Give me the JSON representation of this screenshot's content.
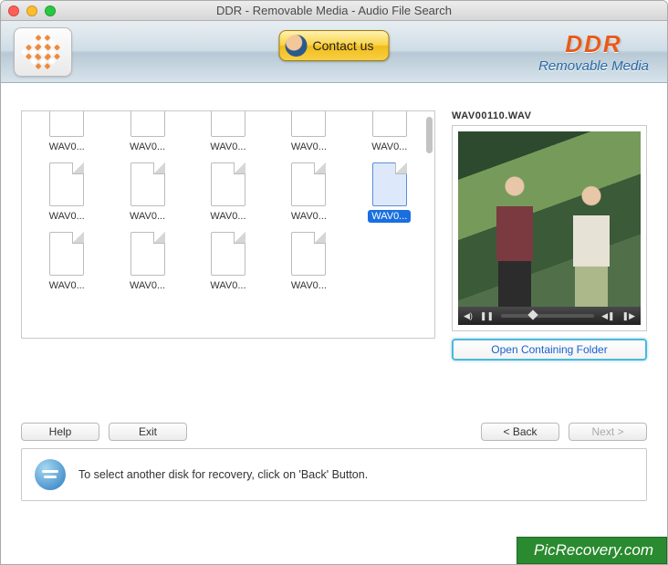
{
  "window": {
    "title": "DDR - Removable Media - Audio File Search"
  },
  "header": {
    "contact_label": "Contact us",
    "brand_title": "DDR",
    "brand_subtitle": "Removable Media"
  },
  "files": {
    "row_top": [
      "WAV0...",
      "WAV0...",
      "WAV0...",
      "WAV0...",
      "WAV0..."
    ],
    "row_mid": [
      "WAV0...",
      "WAV0...",
      "WAV0...",
      "WAV0...",
      "WAV0..."
    ],
    "row_bot": [
      "WAV0...",
      "WAV0...",
      "WAV0...",
      "WAV0...",
      ""
    ],
    "selected_index": 4
  },
  "preview": {
    "filename": "WAV00110.WAV",
    "open_folder_label": "Open Containing Folder"
  },
  "buttons": {
    "help": "Help",
    "exit": "Exit",
    "back": "< Back",
    "next": "Next >"
  },
  "info": {
    "message": "To select another disk for recovery, click on 'Back' Button."
  },
  "watermark": "PicRecovery.com"
}
